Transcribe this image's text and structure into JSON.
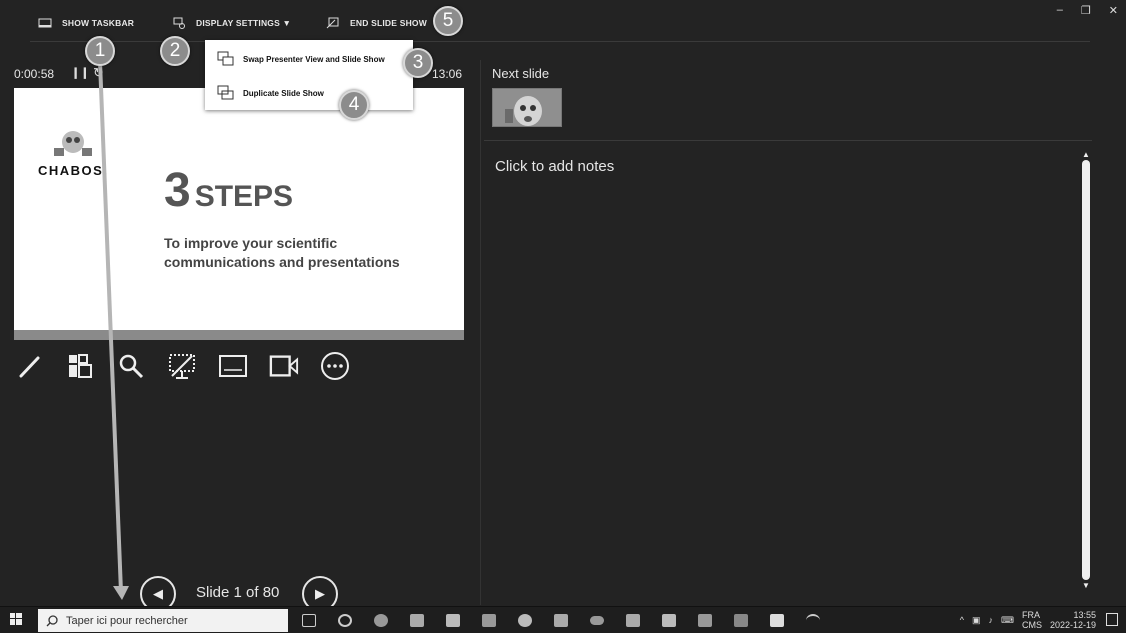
{
  "toolbar": {
    "show_taskbar": "SHOW TASKBAR",
    "display_settings": "DISPLAY SETTINGS ▼",
    "end_slide_show": "END SLIDE SHOW"
  },
  "window": {
    "minimize": "–",
    "restore": "❐",
    "close": "✕"
  },
  "presenter": {
    "timer": "0:00:58",
    "pause_glyph": "❙❙",
    "reset_glyph": "↻",
    "clock": "13:06"
  },
  "menu": {
    "swap": "Swap Presenter View and Slide Show",
    "duplicate": "Duplicate Slide Show"
  },
  "slide": {
    "logo_text": "CHABOS.",
    "number": "3",
    "title": "STEPS",
    "subtitle": "To improve your scientific communications and presentations"
  },
  "tools": [
    "pen-icon",
    "grid-icon",
    "magnifier-icon",
    "blackout-icon",
    "subtitles-icon",
    "camera-icon",
    "more-icon"
  ],
  "next_slide_label": "Next slide",
  "notes_placeholder": "Click to add notes",
  "navigation": {
    "slide_count": "Slide 1 of 80",
    "prev_glyph": "◀",
    "next_glyph": "▶"
  },
  "callouts": [
    "1",
    "2",
    "3",
    "4",
    "5"
  ],
  "taskbar": {
    "search_placeholder": "Taper ici pour rechercher",
    "lang_line1": "FRA",
    "lang_line2": "CMS",
    "time": "13:55",
    "date": "2022-12-19"
  },
  "colors": {
    "background": "#232323",
    "callout": "#8c8c8c",
    "arrow": "#b5b5b5"
  }
}
